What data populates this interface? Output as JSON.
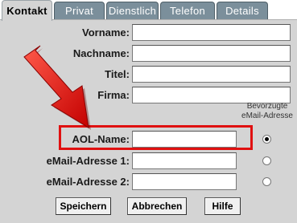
{
  "tabs": [
    {
      "label": "Kontakt",
      "active": true
    },
    {
      "label": "Privat",
      "active": false
    },
    {
      "label": "Dienstlich",
      "active": false
    },
    {
      "label": "Telefon",
      "active": false
    },
    {
      "label": "Details",
      "active": false
    }
  ],
  "form": {
    "vorname_label": "Vorname:",
    "vorname_value": "",
    "nachname_label": "Nachname:",
    "nachname_value": "",
    "titel_label": "Titel:",
    "titel_value": "",
    "firma_label": "Firma:",
    "firma_value": "",
    "aol_label": "AOL-Name:",
    "aol_value": "",
    "email1_label": "eMail-Adresse 1:",
    "email1_value": "",
    "email2_label": "eMail-Adresse 2:",
    "email2_value": "",
    "preferred_hint_line1": "Bevorzugte",
    "preferred_hint_line2": "eMail-Adresse",
    "preferred_selected": "aol"
  },
  "buttons": {
    "save": "Speichern",
    "cancel": "Abbrechen",
    "help": "Hilfe"
  },
  "colors": {
    "panel": "#d4d4d4",
    "tab_inactive": "#7b8f9b",
    "highlight": "#e01010",
    "arrow": "#e01010"
  },
  "icons": {
    "arrow": "red-arrow-icon"
  }
}
